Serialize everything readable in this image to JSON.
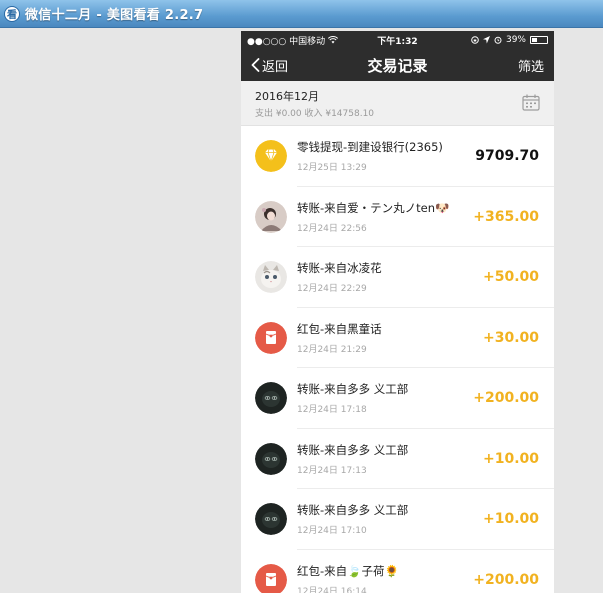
{
  "window": {
    "title": "微信十二月 - 美图看看 2.2.7",
    "icon_glyph": "看"
  },
  "status_bar": {
    "carrier": "●●○○○ 中国移动",
    "time": "下午1:32",
    "battery": "39%",
    "battery_level": 0.39
  },
  "nav": {
    "back_label": "返回",
    "title": "交易记录",
    "filter_label": "筛选"
  },
  "month": {
    "label": "2016年12月",
    "summary": "支出 ¥0.00 收入 ¥14758.10"
  },
  "colors": {
    "income": "#f1b220",
    "expense": "#111111",
    "nav_bg": "#2d2d2d",
    "diamond_bg": "#f4c01b",
    "redpacket_bg": "#e55a47"
  },
  "transactions": [
    {
      "title": "零钱提现-到建设银行(2365)",
      "time": "12月25日 13:29",
      "amount": "9709.70",
      "avatar": "diamond-icon",
      "kind": "withdraw"
    },
    {
      "title": "转账-来自爱・テン丸ノten🐶",
      "time": "12月24日 22:56",
      "amount": "+365.00",
      "avatar": "photo-girl",
      "kind": "income"
    },
    {
      "title": "转账-来自冰凌花",
      "time": "12月24日 22:29",
      "amount": "+50.00",
      "avatar": "photo-cat",
      "kind": "income"
    },
    {
      "title": "红包-来自黑童话",
      "time": "12月24日 21:29",
      "amount": "+30.00",
      "avatar": "red-packet-icon",
      "kind": "income"
    },
    {
      "title": "转账-来自多多 义工部",
      "time": "12月24日 17:18",
      "amount": "+200.00",
      "avatar": "photo-dark",
      "kind": "income"
    },
    {
      "title": "转账-来自多多 义工部",
      "time": "12月24日 17:13",
      "amount": "+10.00",
      "avatar": "photo-dark",
      "kind": "income"
    },
    {
      "title": "转账-来自多多 义工部",
      "time": "12月24日 17:10",
      "amount": "+10.00",
      "avatar": "photo-dark",
      "kind": "income"
    },
    {
      "title": "红包-来自🍃子荷🌻",
      "time": "12月24日 16:14",
      "amount": "+200.00",
      "avatar": "red-packet-icon",
      "kind": "income"
    }
  ]
}
